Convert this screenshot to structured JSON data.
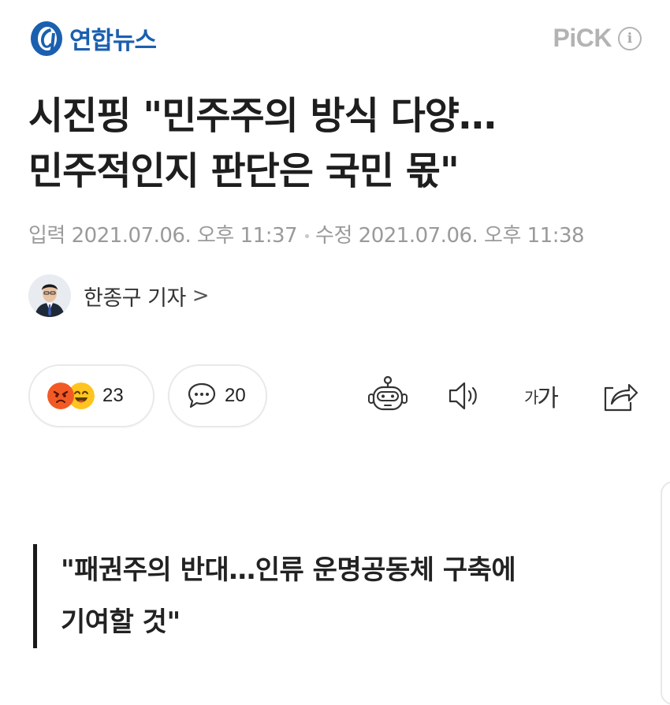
{
  "header": {
    "logo_text": "연합뉴스",
    "pick_label": "PiCK",
    "info_glyph": "i",
    "icons": [
      "yonhap-logo-icon",
      "info-icon"
    ]
  },
  "article": {
    "title_line1": "시진핑 \"민주주의 방식 다양…",
    "title_line2": "민주적인지 판단은 국민 몫\"",
    "published_label": "입력",
    "published_time": "2021.07.06. 오후 11:37",
    "modified_label": "수정",
    "modified_time": "2021.07.06. 오후 11:38",
    "reporter": "한종구 기자",
    "reporter_chevron": ">"
  },
  "actions": {
    "reactions_count": "23",
    "comments_count": "20",
    "font_size_small": "가",
    "font_size_large": "가",
    "icons": [
      "angry-emoji-icon",
      "smile-emoji-icon",
      "comment-bubble-icon",
      "robot-summary-icon",
      "speaker-icon",
      "share-icon"
    ]
  },
  "quote": {
    "line1": "\"패권주의 반대…인류 운명공동체 구축에",
    "line2": "기여할 것\""
  },
  "colors": {
    "brand_blue": "#1b5fb0",
    "angry": "#f25a25",
    "smile": "#ffc41f",
    "muted_text": "#9a9a9a"
  }
}
